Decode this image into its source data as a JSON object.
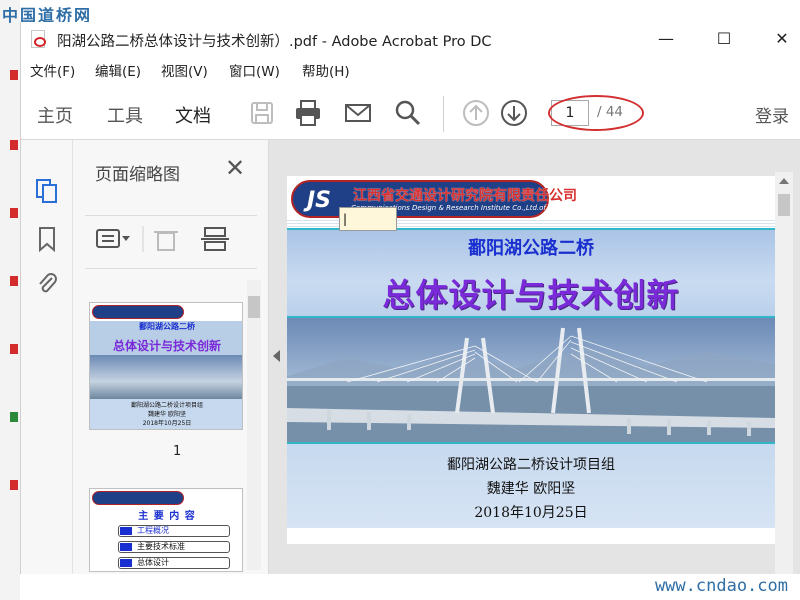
{
  "desktop": {
    "watermark_top": "中国道桥网",
    "watermark_bottom": "www.cndao.com"
  },
  "window": {
    "title": "阳湖公路二桥总体设计与技术创新）.pdf - Adobe Acrobat Pro DC",
    "minimize": "—",
    "maximize": "☐",
    "close": "✕"
  },
  "menu": {
    "items": [
      "文件(F)",
      "编辑(E)",
      "视图(V)",
      "窗口(W)",
      "帮助(H)"
    ]
  },
  "toolbar": {
    "tabs": [
      "主页",
      "工具",
      "文档"
    ],
    "active_tab": "文档",
    "current_page": "1",
    "total_pages": "/ 44",
    "login": "登录"
  },
  "thumbnails_panel": {
    "title": "页面缩略图",
    "close": "✕",
    "page1_label": "1",
    "page1_mini": {
      "subtitle": "鄱阳湖公路二桥",
      "title": "总体设计与技术创新",
      "team": "鄱阳湖公路二桥设计项目组",
      "authors": "魏建华  欧阳坚",
      "date": "2018年10月25日"
    },
    "page2_mini": {
      "heading": "主 要 内 容",
      "items": [
        "工程概况",
        "主要技术标准",
        "总体设计"
      ]
    }
  },
  "slide": {
    "logo_letters": "JS",
    "company_cn": "江西省交通设计研究院有限责任公司",
    "company_en": "Communications Design & Research Institute Co.,Ltd.of Jiangxi Prov.",
    "subtitle": "鄱阳湖公路二桥",
    "title": "总体设计与技术创新",
    "team": "鄱阳湖公路二桥设计项目组",
    "authors": "魏建华    欧阳坚",
    "date": "2018年10月25日"
  },
  "colors": {
    "annotation_ellipse": "#d23030",
    "slide_title": "#7a2ad8",
    "slide_subtitle": "#1a2fcf"
  }
}
